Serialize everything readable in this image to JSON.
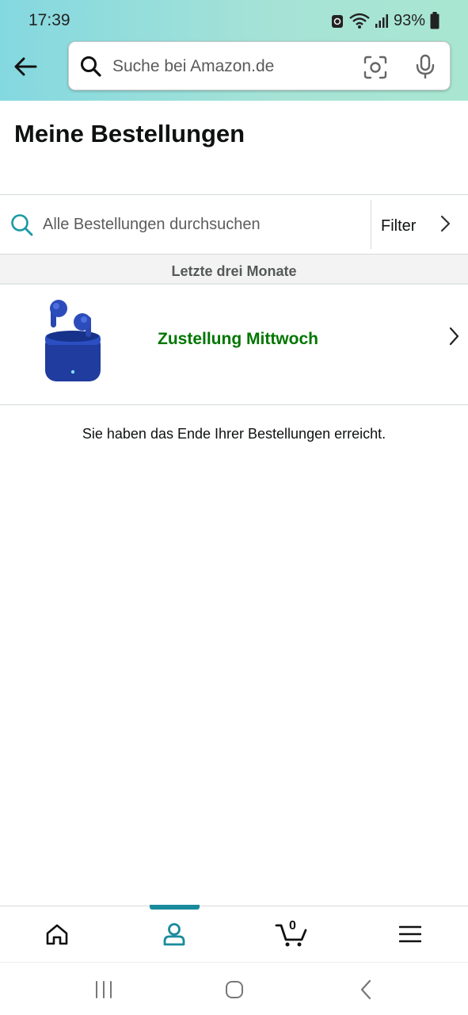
{
  "status_bar": {
    "time": "17:39",
    "battery": "93%"
  },
  "header": {
    "search_placeholder": "Suche bei Amazon.de"
  },
  "page": {
    "title": "Meine Bestellungen"
  },
  "order_search": {
    "placeholder": "Alle Bestellungen durchsuchen",
    "filter_label": "Filter"
  },
  "section": {
    "label": "Letzte drei Monate"
  },
  "orders": [
    {
      "status": "Zustellung Mittwoch",
      "image": "blue-wireless-earbuds-case"
    }
  ],
  "end_message": "Sie haben das Ende Ihrer Bestellungen erreicht.",
  "bottom_nav": {
    "items": [
      "home-icon",
      "account-icon",
      "cart-icon",
      "menu-icon"
    ],
    "active": "account-icon",
    "cart_count": "0"
  },
  "colors": {
    "accent": "#1a8b9d",
    "delivery_green": "#007600",
    "header_start": "#84d8e0",
    "header_end": "#a9e6d1"
  }
}
